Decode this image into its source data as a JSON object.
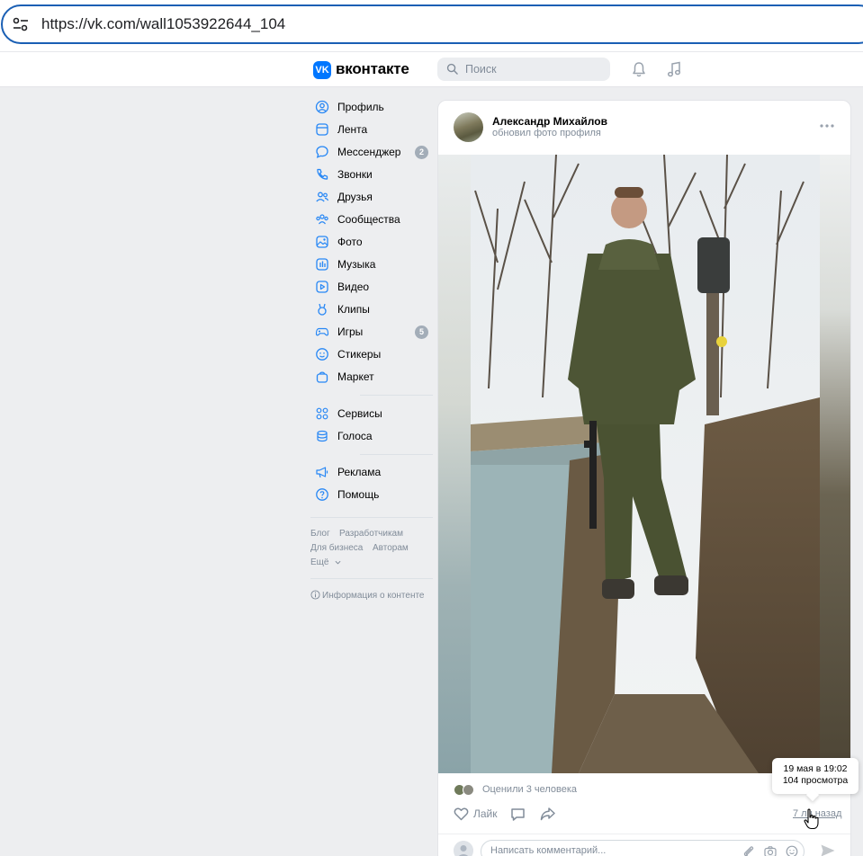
{
  "browser": {
    "url": "https://vk.com/wall1053922644_104"
  },
  "header": {
    "logo_mark": "VK",
    "wordmark": "вконтакте",
    "search_placeholder": "Поиск"
  },
  "nav": {
    "items": [
      {
        "label": "Профиль",
        "icon": "user-circle-icon"
      },
      {
        "label": "Лента",
        "icon": "feed-icon"
      },
      {
        "label": "Мессенджер",
        "icon": "message-icon",
        "badge": "2"
      },
      {
        "label": "Звонки",
        "icon": "phone-icon"
      },
      {
        "label": "Друзья",
        "icon": "friends-icon"
      },
      {
        "label": "Сообщества",
        "icon": "communities-icon"
      },
      {
        "label": "Фото",
        "icon": "photo-icon"
      },
      {
        "label": "Музыка",
        "icon": "music-icon"
      },
      {
        "label": "Видео",
        "icon": "video-icon"
      },
      {
        "label": "Клипы",
        "icon": "clips-icon"
      },
      {
        "label": "Игры",
        "icon": "gamepad-icon",
        "badge": "5"
      },
      {
        "label": "Стикеры",
        "icon": "smile-icon"
      },
      {
        "label": "Маркет",
        "icon": "bag-icon"
      },
      {
        "label": "Сервисы",
        "icon": "services-icon"
      },
      {
        "label": "Голоса",
        "icon": "coins-icon"
      },
      {
        "label": "Реклама",
        "icon": "megaphone-icon"
      },
      {
        "label": "Помощь",
        "icon": "help-icon"
      }
    ],
    "footer_links": [
      "Блог",
      "Разработчикам",
      "Для бизнеса",
      "Авторам",
      "Ещё"
    ],
    "content_info": "Информация о контенте"
  },
  "post": {
    "author": "Александр Михайлов",
    "action": "обновил фото профиля",
    "reactions_text": "Оценили 3 человека",
    "like_label": "Лайк",
    "time_link": "7 лн назад",
    "comment_placeholder": "Написать комментарий..."
  },
  "tooltip": {
    "line1": "19 мая в 19:02",
    "line2": "104 просмотра"
  },
  "colors": {
    "vk_blue": "#0077ff",
    "badge_gray": "#a3adb8",
    "secondary_text": "#818c99",
    "page_bg": "#edeef0"
  }
}
